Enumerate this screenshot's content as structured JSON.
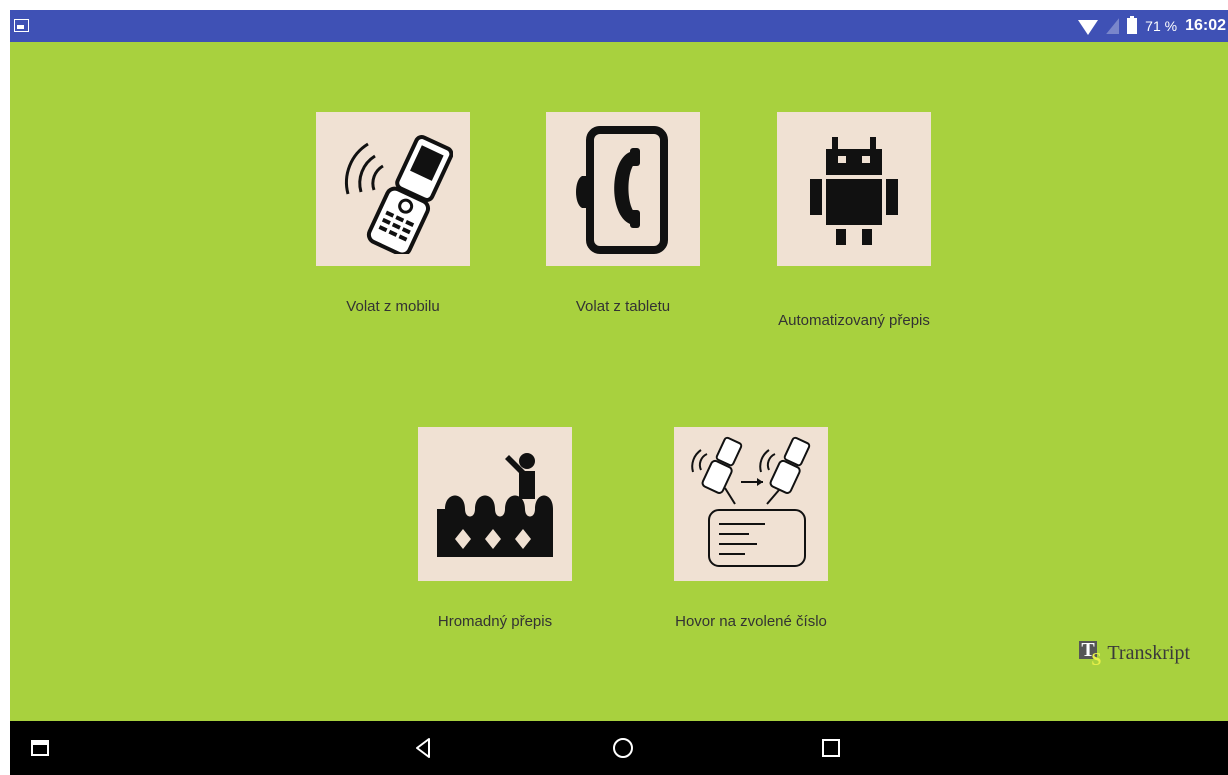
{
  "status_bar": {
    "left_icon": "gallery-icon",
    "wifi_icon": "wifi-icon",
    "sim_icon": "no-sim-icon",
    "battery_icon": "battery-icon",
    "battery_percent": "71 %",
    "time": "16:02"
  },
  "tiles": [
    {
      "label": "Volat z mobilu",
      "icon": "phone-ringing-icon"
    },
    {
      "label": "Volat z tabletu",
      "icon": "tablet-call-icon"
    },
    {
      "label": "Automatizovaný přepis",
      "icon": "android-icon"
    },
    {
      "label": "Hromadný přepis",
      "icon": "crowd-speaker-icon"
    },
    {
      "label": "Hovor na zvolené číslo",
      "icon": "phones-transcript-icon"
    }
  ],
  "logo": {
    "mark_t": "T",
    "mark_s": "S",
    "text": "Transkript"
  },
  "nav_bar": {
    "icons": [
      "recents-app-icon",
      "back-icon",
      "home-icon",
      "overview-icon"
    ]
  },
  "colors": {
    "status_bar": "#3f51b5",
    "background": "#a8d13e",
    "tile": "#f0e1d3",
    "nav_bar": "#000000"
  }
}
